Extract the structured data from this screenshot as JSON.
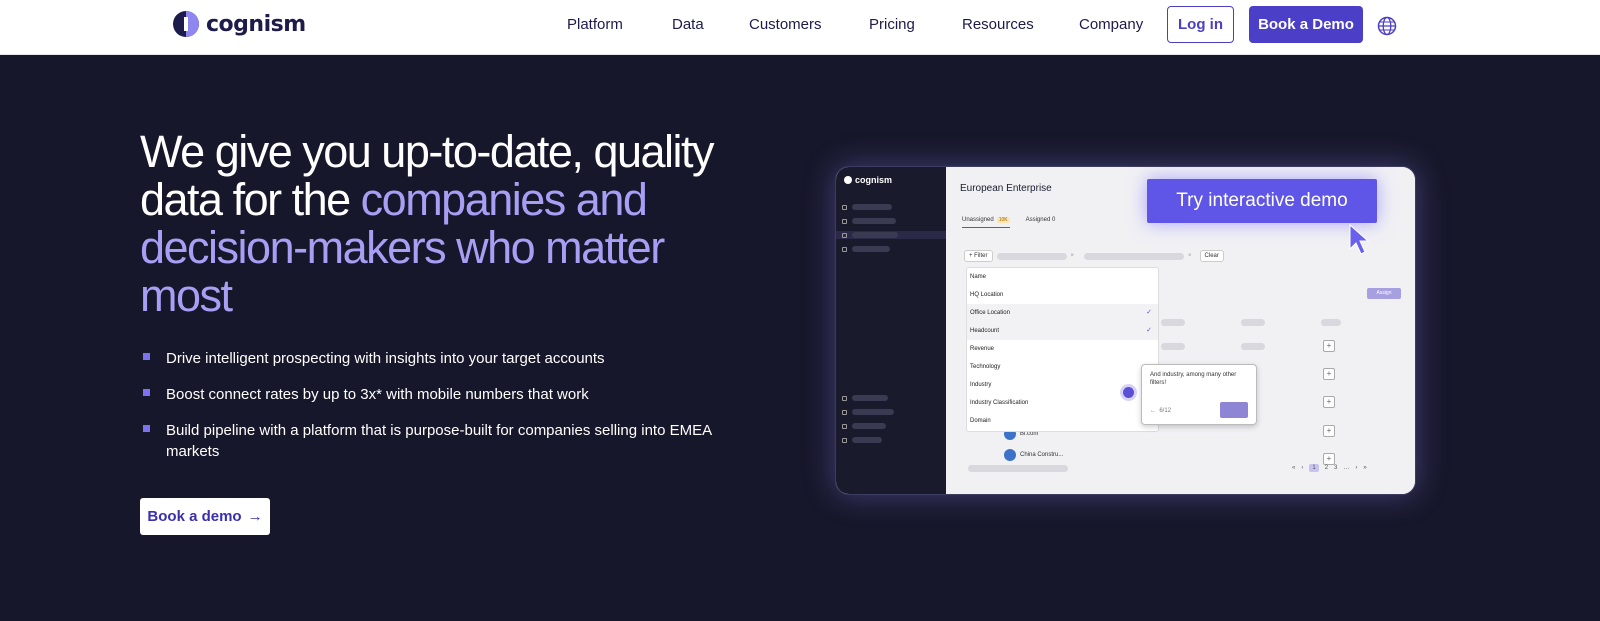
{
  "header": {
    "logo_text": "cognism",
    "nav": [
      "Platform",
      "Data",
      "Customers",
      "Pricing",
      "Resources",
      "Company"
    ],
    "login_label": "Log in",
    "demo_label": "Book a Demo"
  },
  "hero": {
    "headline_part1": "We give you up-to-date, quality data for the ",
    "headline_accent": "companies and decision-makers who matter most",
    "bullets": [
      "Drive intelligent prospecting with insights into your target accounts",
      "Boost connect rates by up to 3x* with mobile numbers that work",
      "Build pipeline with a platform that is purpose-built for companies selling into EMEA markets"
    ],
    "cta_label": "Book a demo",
    "cta_arrow": "→"
  },
  "mockup": {
    "logo_text": "cognism",
    "title": "European Enterprise",
    "tab_unassigned": "Unassigned",
    "tab_unassigned_count": "10K",
    "tab_assigned": "Assigned",
    "tab_assigned_count": "0",
    "filter_label": "+ Filter",
    "clear_label": "Clear",
    "assign_label": "Assign",
    "filter_items": [
      "Name",
      "HQ Location",
      "Office Location",
      "Headcount",
      "Revenue",
      "Technology",
      "Industry",
      "Industry Classification",
      "Domain"
    ],
    "tooltip_text": "And industry, among many other filters!",
    "tooltip_step": "6/12",
    "company_1": "Bi.com",
    "company_2": "China Constru...",
    "pages": [
      "1",
      "2",
      "3"
    ],
    "try_demo_label": "Try interactive demo"
  },
  "colors": {
    "accent": "#4b3ec7",
    "background": "#17172b",
    "headline_accent": "#a89ff5"
  }
}
